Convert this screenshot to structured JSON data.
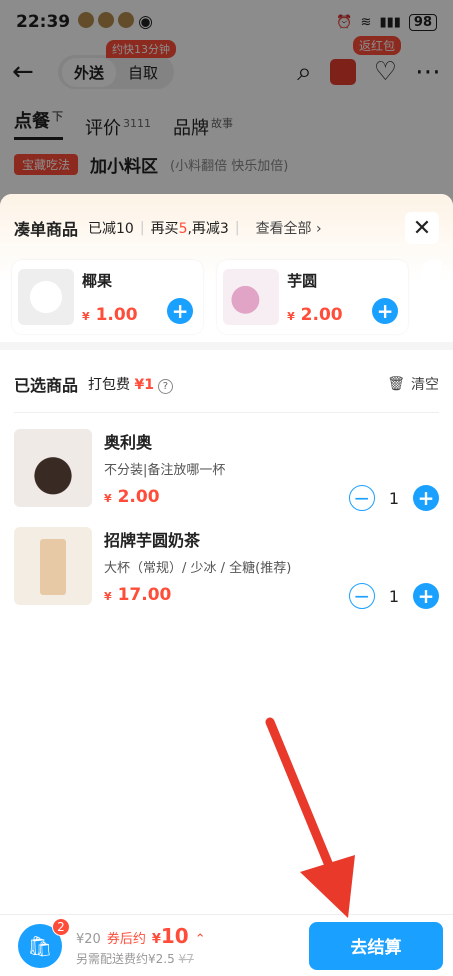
{
  "status": {
    "time": "22:39",
    "battery": "98"
  },
  "nav": {
    "delivery": "外送",
    "pickup": "自取",
    "pickup_badge": "约快13分钟",
    "fav_badge": "返红包"
  },
  "tabs": [
    {
      "label": "点餐",
      "suffix": "下"
    },
    {
      "label": "评价",
      "suffix": "3111"
    },
    {
      "label": "品牌",
      "suffix": "故事"
    }
  ],
  "addon": {
    "tag": "宝藏吃法",
    "title": "加小料区",
    "subtitle": "(小料翻倍 快乐加倍)"
  },
  "combo": {
    "title": "凑单商品",
    "discount": "已减10",
    "buy_more_prefix": "再买",
    "buy_more_amount": "5",
    "buy_more_suffix": ",再减3",
    "see_all": "查看全部",
    "items": [
      {
        "name": "椰果",
        "currency": "¥",
        "price": "1.00"
      },
      {
        "name": "芋圆",
        "currency": "¥",
        "price": "2.00"
      }
    ]
  },
  "selected": {
    "title": "已选商品",
    "pack_fee_label": "打包费",
    "pack_fee_value": "¥1",
    "clear_label": "清空",
    "items": [
      {
        "name": "奥利奥",
        "spec": "不分装|备注放哪一杯",
        "currency": "¥",
        "price": "2.00",
        "qty": "1"
      },
      {
        "name": "招牌芋圆奶茶",
        "spec": "大杯（常规）/ 少冰 / 全糖(推荐)",
        "currency": "¥",
        "price": "17.00",
        "qty": "1"
      }
    ]
  },
  "bottom": {
    "cart_count": "2",
    "original": "¥20",
    "coupon_label": "券后约",
    "currency": "¥",
    "after_price": "10",
    "delivery_note": "另需配送费约¥2.5",
    "delivery_original": "¥7",
    "checkout_label": "去结算"
  },
  "colors": {
    "accent": "#1aa0ff",
    "price": "#ff4d3a",
    "annotation_arrow": "#e8392b"
  }
}
